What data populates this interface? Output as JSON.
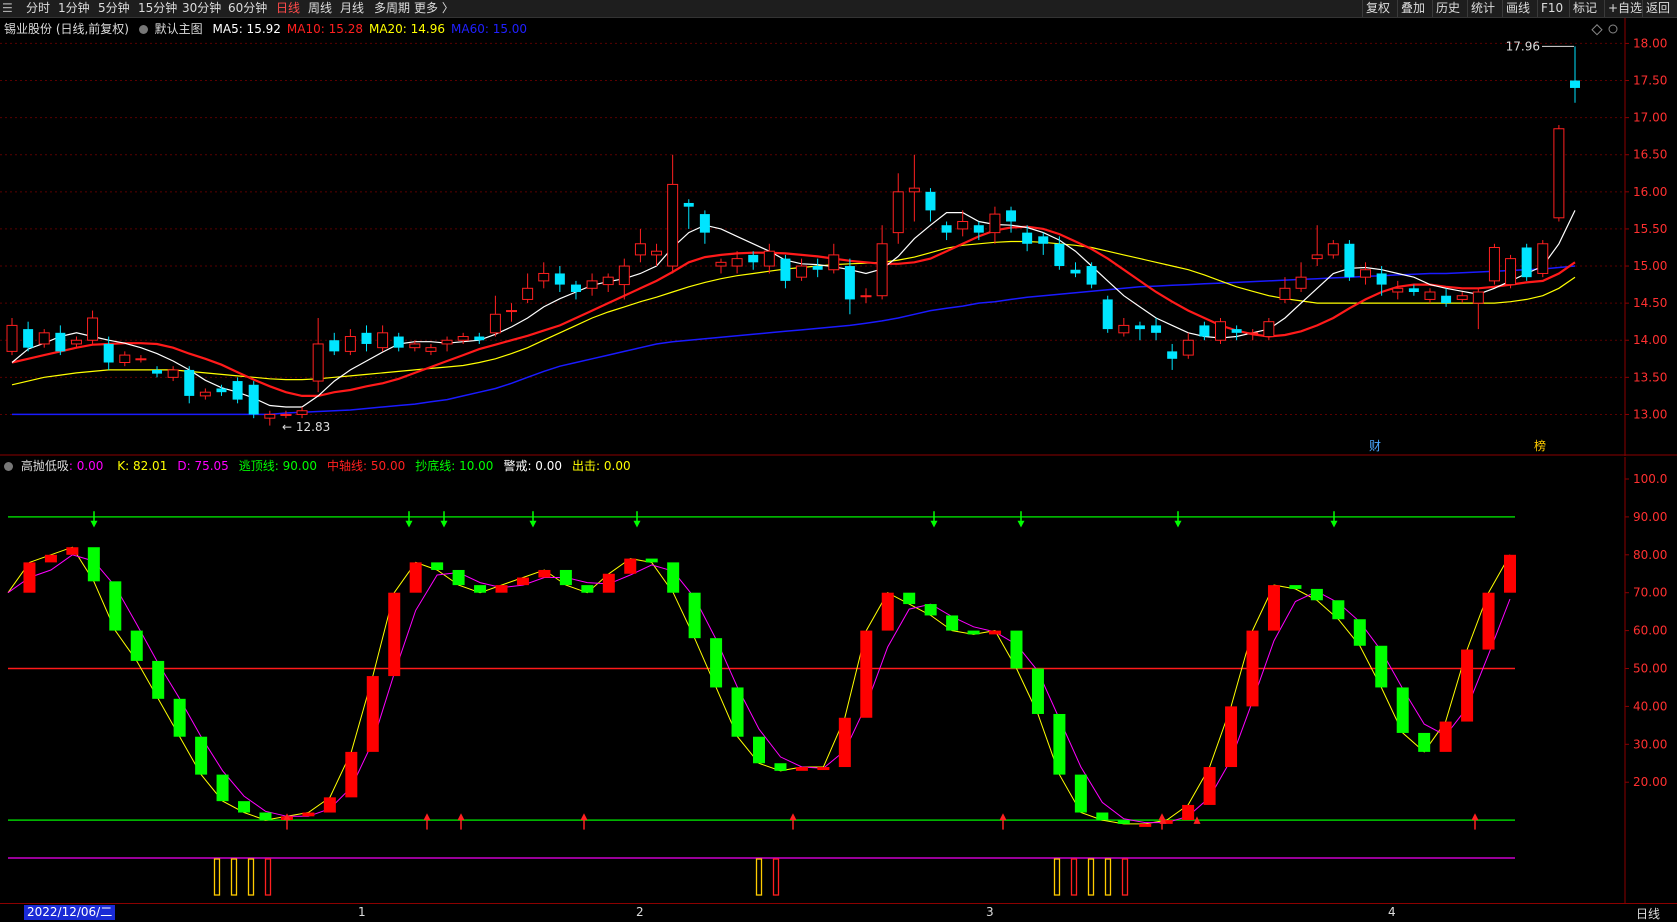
{
  "toolbar": {
    "menu_icon": "menu-icon",
    "periods": [
      "分时",
      "1分钟",
      "5分钟",
      "15分钟",
      "30分钟",
      "60分钟",
      "日线",
      "周线",
      "月线",
      "多周期",
      "更多 〉"
    ],
    "active_period": "日线",
    "right_buttons": [
      "复权",
      "叠加",
      "历史",
      "统计",
      "画线",
      "F10",
      "+自选",
      "返回"
    ],
    "marker_button": "标记"
  },
  "main_chart": {
    "stock_label": "锡业股份 (日线,前复权)",
    "template_label": "默认主图",
    "ma_labels": [
      {
        "text": "MA5: 15.92",
        "color": "#ffffff"
      },
      {
        "text": "MA10: 15.28",
        "color": "#ff2020"
      },
      {
        "text": "MA20: 14.96",
        "color": "#ffff00"
      },
      {
        "text": "MA60: 15.00",
        "color": "#2020ff"
      }
    ],
    "high_label": "17.96",
    "low_label": "12.83",
    "markers": [
      "财",
      "榜"
    ],
    "y_ticks": [
      "18.00",
      "17.50",
      "17.00",
      "16.50",
      "16.00",
      "15.50",
      "15.00",
      "14.50",
      "14.00",
      "13.50",
      "13.00"
    ]
  },
  "indicator": {
    "name": "高抛低吸",
    "value_label": ": 0.00",
    "labels": [
      {
        "text": "K: 82.01",
        "color": "#ffff00"
      },
      {
        "text": "D: 75.05",
        "color": "#ff00ff"
      },
      {
        "text": "逃顶线: 90.00",
        "color": "#00ff00"
      },
      {
        "text": "中轴线: 50.00",
        "color": "#ff2020"
      },
      {
        "text": "抄底线: 10.00",
        "color": "#00ff00"
      },
      {
        "text": "警戒: 0.00",
        "color": "#ffffff"
      },
      {
        "text": "出击: 0.00",
        "color": "#ffff00"
      }
    ],
    "y_ticks": [
      "100.0",
      "90.00",
      "80.00",
      "70.00",
      "60.00",
      "50.00",
      "40.00",
      "30.00",
      "20.00"
    ]
  },
  "x_axis": {
    "date_badge": "2022/12/06/二",
    "month_labels": [
      "1",
      "2",
      "3",
      "4"
    ],
    "period_label": "日线"
  },
  "colors": {
    "up": "#ff2020",
    "down": "#00e5ff",
    "grid": "#5a0000",
    "k_up": "#ff0000",
    "k_down": "#00ff00"
  },
  "chart_data": {
    "type": "candlestick",
    "ylim": [
      12.75,
      18.1
    ],
    "candles": [
      [
        13.85,
        14.2,
        14.3,
        13.8
      ],
      [
        14.15,
        13.9,
        14.25,
        13.85
      ],
      [
        13.95,
        14.1,
        14.15,
        13.9
      ],
      [
        14.1,
        13.85,
        14.2,
        13.8
      ],
      [
        13.95,
        14.0,
        14.05,
        13.9
      ],
      [
        14.0,
        14.3,
        14.4,
        13.95
      ],
      [
        13.95,
        13.7,
        14.05,
        13.6
      ],
      [
        13.7,
        13.8,
        13.85,
        13.65
      ],
      [
        13.75,
        13.75,
        13.8,
        13.7
      ],
      [
        13.6,
        13.55,
        13.65,
        13.5
      ],
      [
        13.5,
        13.6,
        13.65,
        13.45
      ],
      [
        13.6,
        13.25,
        13.65,
        13.15
      ],
      [
        13.25,
        13.3,
        13.35,
        13.2
      ],
      [
        13.35,
        13.3,
        13.4,
        13.25
      ],
      [
        13.45,
        13.2,
        13.5,
        13.15
      ],
      [
        13.4,
        13.0,
        13.45,
        12.95
      ],
      [
        12.95,
        13.0,
        13.05,
        12.85
      ],
      [
        13.0,
        13.0,
        13.05,
        12.95
      ],
      [
        13.0,
        13.05,
        13.1,
        12.95
      ],
      [
        13.45,
        13.95,
        14.3,
        13.3
      ],
      [
        14.0,
        13.85,
        14.1,
        13.8
      ],
      [
        13.85,
        14.05,
        14.15,
        13.8
      ],
      [
        14.1,
        13.95,
        14.2,
        13.85
      ],
      [
        13.9,
        14.1,
        14.2,
        13.85
      ],
      [
        14.05,
        13.9,
        14.1,
        13.85
      ],
      [
        13.9,
        13.95,
        14.0,
        13.85
      ],
      [
        13.85,
        13.9,
        13.95,
        13.8
      ],
      [
        13.95,
        14.0,
        14.05,
        13.85
      ],
      [
        14.0,
        14.05,
        14.1,
        13.95
      ],
      [
        14.05,
        14.0,
        14.1,
        13.95
      ],
      [
        14.1,
        14.35,
        14.6,
        14.05
      ],
      [
        14.4,
        14.4,
        14.5,
        14.25
      ],
      [
        14.55,
        14.7,
        14.9,
        14.5
      ],
      [
        14.8,
        14.9,
        15.05,
        14.7
      ],
      [
        14.9,
        14.75,
        15.0,
        14.65
      ],
      [
        14.75,
        14.65,
        14.8,
        14.55
      ],
      [
        14.7,
        14.8,
        14.9,
        14.6
      ],
      [
        14.75,
        14.85,
        14.9,
        14.65
      ],
      [
        14.75,
        15.0,
        15.1,
        14.55
      ],
      [
        15.15,
        15.3,
        15.5,
        15.05
      ],
      [
        15.15,
        15.2,
        15.3,
        15.0
      ],
      [
        15.0,
        16.1,
        16.5,
        14.9
      ],
      [
        15.85,
        15.8,
        15.9,
        15.5
      ],
      [
        15.7,
        15.45,
        15.75,
        15.3
      ],
      [
        15.0,
        15.05,
        15.1,
        14.9
      ],
      [
        15.0,
        15.1,
        15.2,
        14.9
      ],
      [
        15.15,
        15.05,
        15.2,
        14.95
      ],
      [
        15.0,
        15.2,
        15.3,
        14.9
      ],
      [
        15.1,
        14.8,
        15.15,
        14.7
      ],
      [
        14.85,
        15.0,
        15.1,
        14.8
      ],
      [
        15.0,
        14.95,
        15.1,
        14.85
      ],
      [
        14.95,
        15.15,
        15.3,
        14.9
      ],
      [
        15.0,
        14.55,
        15.1,
        14.35
      ],
      [
        14.6,
        14.6,
        14.7,
        14.5
      ],
      [
        14.6,
        15.3,
        15.55,
        14.55
      ],
      [
        15.45,
        16.0,
        16.25,
        15.3
      ],
      [
        16.0,
        16.05,
        16.5,
        15.6
      ],
      [
        16.0,
        15.75,
        16.05,
        15.6
      ],
      [
        15.55,
        15.45,
        15.6,
        15.35
      ],
      [
        15.5,
        15.6,
        15.75,
        15.4
      ],
      [
        15.55,
        15.45,
        15.6,
        15.35
      ],
      [
        15.45,
        15.7,
        15.8,
        15.3
      ],
      [
        15.75,
        15.6,
        15.8,
        15.45
      ],
      [
        15.45,
        15.3,
        15.55,
        15.2
      ],
      [
        15.4,
        15.3,
        15.45,
        15.15
      ],
      [
        15.3,
        15.0,
        15.4,
        14.95
      ],
      [
        14.95,
        14.9,
        15.05,
        14.85
      ],
      [
        15.0,
        14.75,
        15.05,
        14.7
      ],
      [
        14.55,
        14.15,
        14.6,
        14.1
      ],
      [
        14.1,
        14.2,
        14.3,
        14.05
      ],
      [
        14.2,
        14.15,
        14.25,
        14.0
      ],
      [
        14.2,
        14.1,
        14.3,
        14.0
      ],
      [
        13.85,
        13.75,
        13.95,
        13.6
      ],
      [
        13.8,
        14.0,
        14.1,
        13.75
      ],
      [
        14.2,
        14.05,
        14.25,
        14.0
      ],
      [
        14.0,
        14.25,
        14.3,
        13.95
      ],
      [
        14.15,
        14.1,
        14.2,
        14.0
      ],
      [
        14.1,
        14.1,
        14.15,
        14.0
      ],
      [
        14.05,
        14.25,
        14.3,
        14.0
      ],
      [
        14.55,
        14.7,
        14.85,
        14.5
      ],
      [
        14.7,
        14.85,
        15.05,
        14.65
      ],
      [
        15.1,
        15.15,
        15.55,
        15.0
      ],
      [
        15.15,
        15.3,
        15.35,
        15.1
      ],
      [
        15.3,
        14.85,
        15.35,
        14.8
      ],
      [
        14.85,
        14.95,
        15.05,
        14.75
      ],
      [
        14.9,
        14.75,
        15.0,
        14.6
      ],
      [
        14.65,
        14.7,
        14.8,
        14.55
      ],
      [
        14.7,
        14.65,
        14.75,
        14.6
      ],
      [
        14.55,
        14.65,
        14.7,
        14.5
      ],
      [
        14.6,
        14.5,
        14.7,
        14.45
      ],
      [
        14.55,
        14.6,
        14.65,
        14.5
      ],
      [
        14.5,
        14.65,
        14.7,
        14.15
      ],
      [
        14.8,
        15.25,
        15.3,
        14.75
      ],
      [
        14.75,
        15.1,
        15.15,
        14.7
      ],
      [
        15.25,
        14.85,
        15.3,
        14.8
      ],
      [
        14.9,
        15.3,
        15.35,
        14.85
      ],
      [
        15.65,
        16.85,
        16.9,
        15.6
      ],
      [
        17.5,
        17.4,
        17.96,
        17.2
      ]
    ],
    "ma5": [
      13.7,
      13.88,
      13.96,
      14.05,
      14.1,
      14.05,
      14.0,
      13.96,
      13.9,
      13.82,
      13.72,
      13.6,
      13.46,
      13.36,
      13.3,
      13.22,
      13.12,
      13.1,
      13.1,
      13.25,
      13.45,
      13.6,
      13.72,
      13.84,
      13.95,
      13.98,
      13.98,
      13.96,
      13.98,
      14.0,
      14.08,
      14.18,
      14.3,
      14.45,
      14.56,
      14.65,
      14.74,
      14.79,
      14.83,
      14.9,
      15.0,
      15.25,
      15.45,
      15.55,
      15.5,
      15.4,
      15.3,
      15.2,
      15.08,
      15.03,
      15.02,
      14.99,
      14.95,
      14.9,
      14.96,
      15.13,
      15.37,
      15.55,
      15.72,
      15.72,
      15.6,
      15.56,
      15.55,
      15.52,
      15.45,
      15.35,
      15.2,
      15.0,
      14.8,
      14.6,
      14.45,
      14.3,
      14.2,
      14.1,
      14.05,
      14.03,
      14.05,
      14.1,
      14.15,
      14.3,
      14.5,
      14.7,
      14.9,
      14.97,
      14.98,
      14.95,
      14.9,
      14.85,
      14.75,
      14.7,
      14.66,
      14.62,
      14.7,
      14.8,
      14.9,
      15.0,
      15.3,
      15.75
    ],
    "ma10": [
      13.7,
      13.75,
      13.8,
      13.85,
      13.9,
      13.94,
      13.95,
      13.96,
      13.96,
      13.95,
      13.9,
      13.82,
      13.75,
      13.67,
      13.57,
      13.47,
      13.38,
      13.3,
      13.25,
      13.25,
      13.3,
      13.33,
      13.38,
      13.42,
      13.48,
      13.56,
      13.64,
      13.72,
      13.8,
      13.88,
      13.94,
      14.0,
      14.06,
      14.13,
      14.2,
      14.3,
      14.4,
      14.5,
      14.6,
      14.7,
      14.8,
      14.92,
      15.05,
      15.12,
      15.15,
      15.17,
      15.18,
      15.18,
      15.17,
      15.15,
      15.13,
      15.1,
      15.07,
      15.05,
      15.03,
      15.03,
      15.05,
      15.1,
      15.2,
      15.3,
      15.4,
      15.48,
      15.52,
      15.53,
      15.5,
      15.43,
      15.33,
      15.23,
      15.1,
      14.95,
      14.8,
      14.65,
      14.52,
      14.4,
      14.3,
      14.2,
      14.13,
      14.08,
      14.05,
      14.07,
      14.12,
      14.2,
      14.3,
      14.43,
      14.55,
      14.65,
      14.72,
      14.75,
      14.75,
      14.72,
      14.7,
      14.7,
      14.72,
      14.75,
      14.78,
      14.8,
      14.9,
      15.05
    ],
    "ma20": [
      13.4,
      13.45,
      13.5,
      13.53,
      13.56,
      13.58,
      13.6,
      13.6,
      13.6,
      13.6,
      13.6,
      13.58,
      13.56,
      13.54,
      13.52,
      13.5,
      13.48,
      13.47,
      13.47,
      13.48,
      13.5,
      13.52,
      13.54,
      13.56,
      13.58,
      13.6,
      13.62,
      13.64,
      13.66,
      13.7,
      13.75,
      13.82,
      13.9,
      14.0,
      14.1,
      14.2,
      14.3,
      14.38,
      14.45,
      14.52,
      14.58,
      14.65,
      14.72,
      14.78,
      14.83,
      14.87,
      14.9,
      14.93,
      14.96,
      14.98,
      15.0,
      15.02,
      15.03,
      15.04,
      15.05,
      15.08,
      15.12,
      15.18,
      15.24,
      15.28,
      15.3,
      15.32,
      15.33,
      15.33,
      15.32,
      15.3,
      15.28,
      15.25,
      15.2,
      15.15,
      15.1,
      15.05,
      15.0,
      14.95,
      14.88,
      14.8,
      14.72,
      14.66,
      14.6,
      14.56,
      14.53,
      14.5,
      14.5,
      14.5,
      14.5,
      14.5,
      14.5,
      14.5,
      14.5,
      14.5,
      14.5,
      14.5,
      14.5,
      14.52,
      14.55,
      14.6,
      14.7,
      14.85
    ],
    "ma60": [
      13.0,
      13.0,
      13.0,
      13.0,
      13.0,
      13.0,
      13.0,
      13.0,
      13.0,
      13.0,
      13.0,
      13.0,
      13.0,
      13.0,
      13.0,
      13.0,
      13.0,
      13.02,
      13.03,
      13.04,
      13.05,
      13.06,
      13.08,
      13.1,
      13.12,
      13.14,
      13.17,
      13.2,
      13.25,
      13.3,
      13.35,
      13.42,
      13.5,
      13.58,
      13.65,
      13.7,
      13.75,
      13.8,
      13.85,
      13.9,
      13.95,
      13.98,
      14.0,
      14.02,
      14.04,
      14.06,
      14.08,
      14.1,
      14.12,
      14.14,
      14.16,
      14.18,
      14.2,
      14.23,
      14.26,
      14.3,
      14.35,
      14.4,
      14.43,
      14.46,
      14.5,
      14.52,
      14.55,
      14.58,
      14.6,
      14.62,
      14.64,
      14.66,
      14.68,
      14.7,
      14.72,
      14.73,
      14.74,
      14.75,
      14.76,
      14.77,
      14.78,
      14.79,
      14.8,
      14.81,
      14.82,
      14.83,
      14.84,
      14.85,
      14.86,
      14.87,
      14.88,
      14.89,
      14.9,
      14.9,
      14.91,
      14.92,
      14.93,
      14.94,
      14.95,
      14.96,
      14.98,
      15.0
    ],
    "k_values": [
      70,
      78,
      80,
      82,
      73,
      60,
      52,
      42,
      32,
      22,
      15,
      12,
      10,
      11,
      12,
      16,
      28,
      48,
      70,
      78,
      76,
      72,
      70,
      72,
      74,
      76,
      72,
      70,
      75,
      79,
      78,
      70,
      58,
      45,
      32,
      25,
      23,
      24,
      24,
      37,
      60,
      70,
      67,
      64,
      60,
      59,
      60,
      50,
      38,
      22,
      12,
      10,
      9,
      9,
      10,
      14,
      24,
      40,
      60,
      72,
      71,
      68,
      63,
      56,
      45,
      33,
      28,
      36,
      55,
      70,
      80
    ]
  }
}
